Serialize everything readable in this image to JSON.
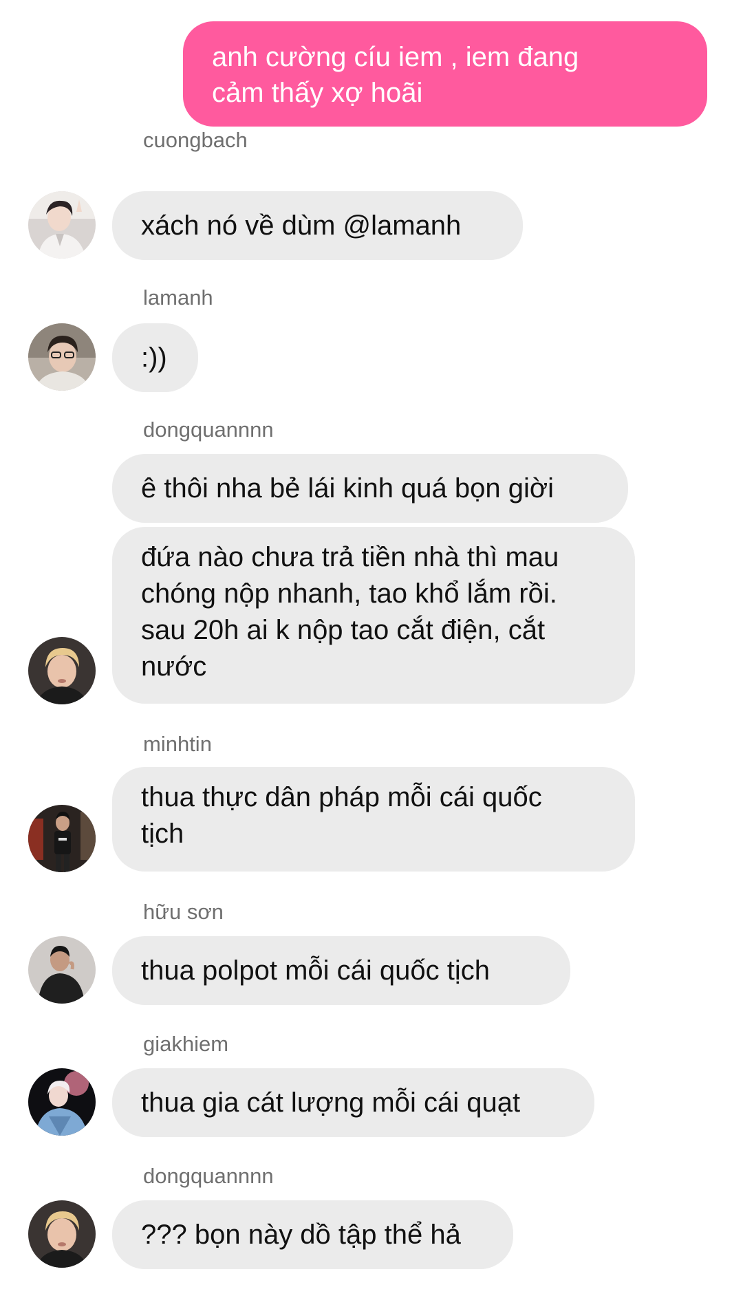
{
  "outgoing": {
    "text": "anh cường cíu iem , iem đang\ncảm thấy xợ hoãi"
  },
  "messages": [
    {
      "sender": "cuongbach",
      "text": "xách nó về dùm @lamanh"
    },
    {
      "sender": "lamanh",
      "text": ":))"
    },
    {
      "sender": "dongquannnn",
      "text": "ê thôi nha bẻ lái kinh quá bọn giời"
    },
    {
      "text": "đứa nào chưa trả tiền nhà thì mau\nchóng nộp nhanh, tao khổ lắm rồi.\nsau 20h ai k nộp tao cắt điện, cắt\nnước"
    },
    {
      "sender": "minhtin",
      "text": "thua thực dân pháp mỗi cái quốc\ntịch"
    },
    {
      "sender": "hữu sơn",
      "text": "thua polpot mỗi cái quốc tịch"
    },
    {
      "sender": "giakhiem",
      "text": "thua gia cát lượng mỗi cái quạt"
    },
    {
      "sender": "dongquannnn",
      "text": "??? bọn này dồ tập thể hả"
    }
  ],
  "colors": {
    "outgoing_bubble": "#ff5a9e",
    "incoming_bubble": "#ebebeb",
    "sender_name": "#6f6f6f"
  }
}
